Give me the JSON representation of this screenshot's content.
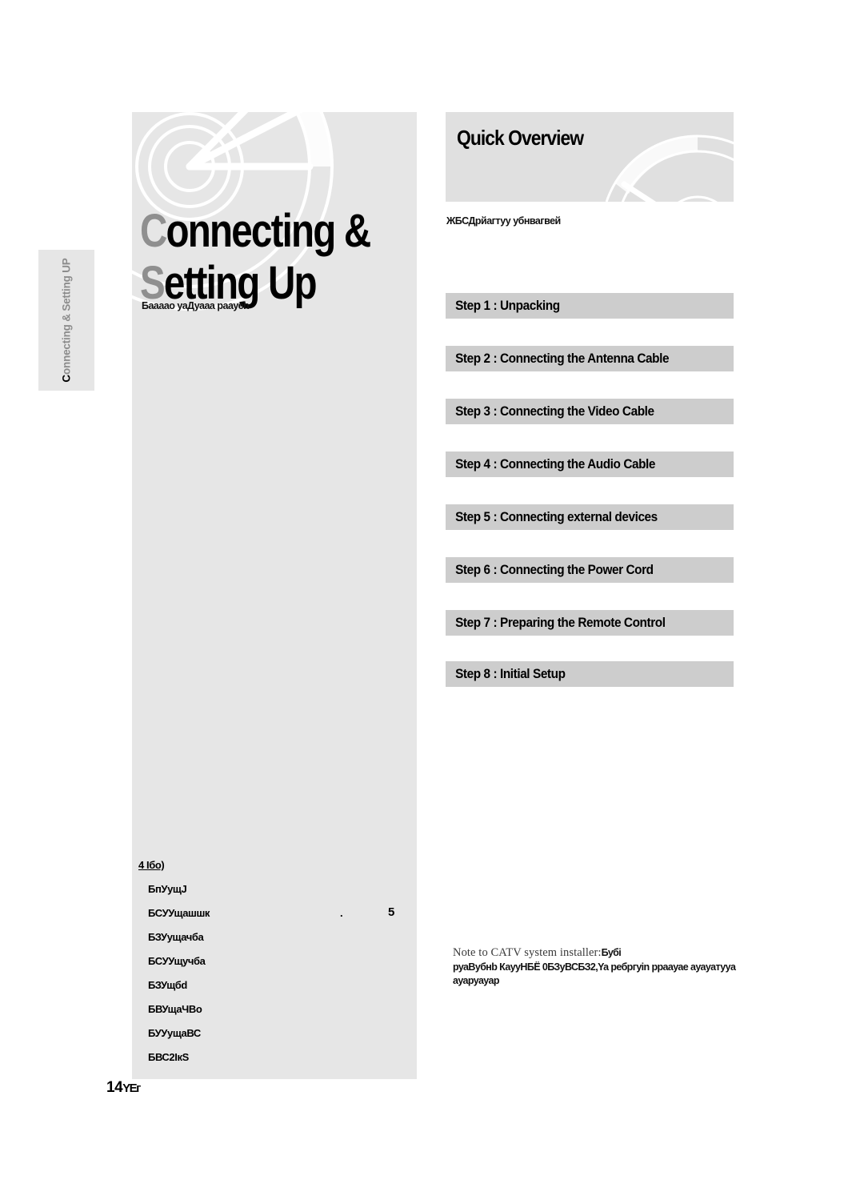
{
  "page": {
    "footer_page_number": "14",
    "footer_suffix": "YΕг"
  },
  "chapter_tab": {
    "initial": "C",
    "label_rest": "onnecting & Setting UP",
    "full_label": "Connecting & Setting UP"
  },
  "title": {
    "line1_cap": "C",
    "line1_rest": "onnecting &",
    "line2_cap": "S",
    "line2_rest": "etting Up",
    "full": "Connecting & Setting Up"
  },
  "intro_lines": [
    "Баааао",
    "уаДуааа",
    "раауеh"
  ],
  "overview": {
    "header_title": "Quick Overview",
    "note_lines": [
      "ЖБСДрйагтуу",
      "убнвагвей"
    ],
    "steps": [
      "Step 1 : Unpacking",
      "Step 2 : Connecting the Antenna Cable",
      "Step 3 : Connecting the Video Cable",
      "Step 4 : Connecting the Audio Cable",
      "Step 5 : Connecting external devices",
      "Step 6 : Connecting the Power Cord",
      "Step 7 : Preparing the Remote Control",
      "Step 8 : Initial Setup"
    ]
  },
  "toc": {
    "heading": "4 Ібо)",
    "rows": [
      {
        "label": "БпУущJ",
        "dots": "",
        "page": ""
      },
      {
        "label": "БСУУщашшк",
        "dots": ".",
        "page": "5"
      },
      {
        "label": "БЗУущачбa",
        "dots": "",
        "page": ""
      },
      {
        "label": "БСУУщучбa",
        "dots": "",
        "page": ""
      },
      {
        "label": "БЗУщбd",
        "dots": "",
        "page": ""
      },
      {
        "label": "БВУщаЧВо",
        "dots": "",
        "page": ""
      },
      {
        "label": "БУУущаВС",
        "dots": "",
        "page": ""
      },
      {
        "label": "БВС2ІкS",
        "dots": "",
        "page": ""
      }
    ]
  },
  "catv_note": {
    "lead": "Note to CATV system installer:",
    "lead_tail": "Бубі",
    "body_lines": [
      "руаВубнb",
      "КаууНБЁ",
      "0БЗуВСБЗ2,Ya",
      "ребргуin",
      "рраауае",
      "ауауатууa",
      "ауаруауар"
    ]
  },
  "colors": {
    "panel_gray": "#e6e6e6",
    "step_bar_gray": "#cdcdcd",
    "header_gray": "#e0e0e0",
    "title_cap_gray": "#8f8f8f",
    "text_black": "#000000"
  }
}
